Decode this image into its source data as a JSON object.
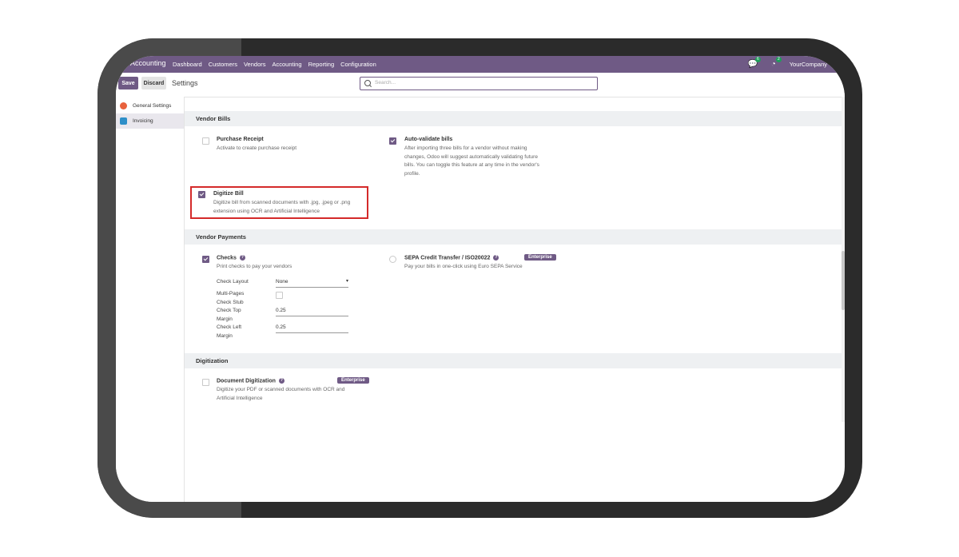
{
  "topbar": {
    "app_name": "Accounting",
    "menu": [
      "Dashboard",
      "Customers",
      "Vendors",
      "Accounting",
      "Reporting",
      "Configuration"
    ],
    "messages_count": "6",
    "activities_count": "2",
    "company": "YourCompany"
  },
  "controls": {
    "save_label": "Save",
    "discard_label": "Discard",
    "breadcrumb": "Settings",
    "search_placeholder": "Search..."
  },
  "sidebar": {
    "items": [
      {
        "label": "General Settings",
        "icon": "general-settings-icon",
        "color": "#e8623d"
      },
      {
        "label": "Invoicing",
        "icon": "invoicing-icon",
        "color": "#2e8fc8"
      }
    ]
  },
  "vendor_bills": {
    "title": "Vendor Bills",
    "purchase_receipt": {
      "title": "Purchase Receipt",
      "desc": "Activate to create purchase receipt",
      "checked": false
    },
    "auto_validate": {
      "title": "Auto-validate bills",
      "desc": [
        "After importing three bills for a vendor without making",
        "changes, Odoo will suggest automatically validating future",
        "bills. You can toggle this feature at any time in the vendor's",
        "profile."
      ],
      "checked": true
    },
    "digitize_bill": {
      "title": "Digitize Bill",
      "desc": [
        "Digitize bill from scanned documents with .jpg, .jpeg or .png",
        "extension using OCR and Artificial Intelligence"
      ],
      "checked": true
    }
  },
  "vendor_payments": {
    "title": "Vendor Payments",
    "checks": {
      "title": "Checks",
      "desc": "Print checks to pay your vendors",
      "checked": true,
      "fields": {
        "check_layout_label": "Check Layout",
        "check_layout_value": "None",
        "multi_pages_label": [
          "Multi-Pages",
          "Check Stub"
        ],
        "check_top_margin_label": [
          "Check Top",
          "Margin"
        ],
        "check_top_margin_value": "0.25",
        "check_left_margin_label": [
          "Check Left",
          "Margin"
        ],
        "check_left_margin_value": "0.25"
      }
    },
    "sepa": {
      "title": "SEPA Credit Transfer / ISO20022",
      "badge": "Enterprise",
      "desc": "Pay your bills in one-click using Euro SEPA Service"
    }
  },
  "digitization": {
    "title": "Digitization",
    "document_digitization": {
      "title": "Document Digitization",
      "badge": "Enterprise",
      "desc": [
        "Digitize your PDF or scanned documents with OCR and",
        "Artificial Intelligence"
      ]
    }
  },
  "colors": {
    "brand": "#6f5a85",
    "highlight": "#d42a2a"
  }
}
